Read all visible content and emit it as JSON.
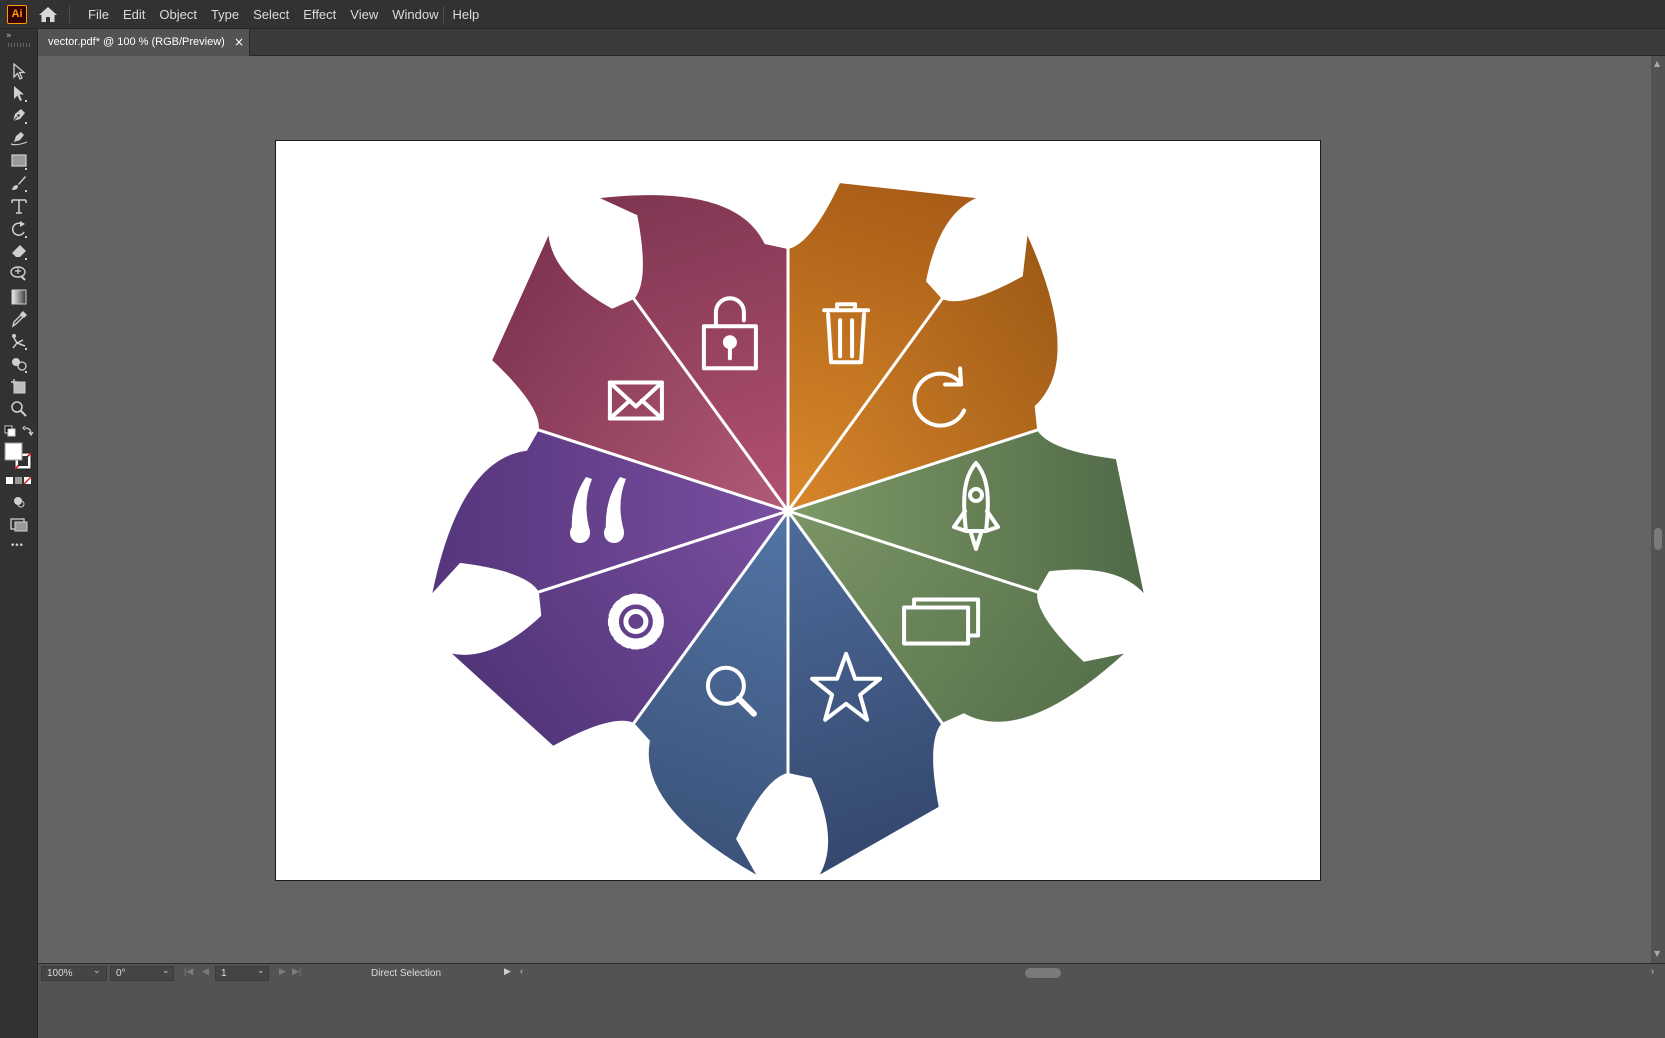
{
  "app": {
    "logo_text": "Ai",
    "brand_color": "#ff9a00",
    "menus": [
      "File",
      "Edit",
      "Object",
      "Type",
      "Select",
      "Effect",
      "View",
      "Window",
      "Help"
    ]
  },
  "document": {
    "tab_title": "vector.pdf* @ 100 % (RGB/Preview)",
    "close_glyph": "×"
  },
  "toolbar": {
    "collapse_glyph": "»",
    "tools": [
      "selection-tool",
      "direct-selection-tool",
      "pen-tool",
      "curvature-tool",
      "rectangle-tool",
      "paintbrush-tool",
      "type-tool",
      "rotate-tool",
      "eraser-tool",
      "width-tool",
      "gradient-tool",
      "eyedropper-tool",
      "puppet-warp-tool",
      "shape-builder-tool",
      "artboard-tool",
      "zoom-tool"
    ],
    "fill_color": "#ffffff",
    "stroke": "none",
    "more_glyph": "•••"
  },
  "artwork": {
    "segments": [
      {
        "icon": "trash-icon",
        "color_light": "#d98a2a",
        "color_dark": "#a65a16"
      },
      {
        "icon": "refresh-icon",
        "color_light": "#d8862a",
        "color_dark": "#9d5916"
      },
      {
        "icon": "rocket-icon",
        "color_light": "#7e9a66",
        "color_dark": "#4f6848"
      },
      {
        "icon": "windows-icon",
        "color_light": "#7b9566",
        "color_dark": "#55704b"
      },
      {
        "icon": "star-icon",
        "color_light": "#4d6b9a",
        "color_dark": "#34476d"
      },
      {
        "icon": "magnifier-icon",
        "color_light": "#5275a5",
        "color_dark": "#3b5279"
      },
      {
        "icon": "gear-icon",
        "color_light": "#7a4fa0",
        "color_dark": "#4f3477"
      },
      {
        "icon": "quote-icon",
        "color_light": "#7a4fa2",
        "color_dark": "#54357a"
      },
      {
        "icon": "envelope-icon",
        "color_light": "#b25a76",
        "color_dark": "#7e3351"
      },
      {
        "icon": "padlock-icon",
        "color_light": "#b25073",
        "color_dark": "#7d3550"
      }
    ]
  },
  "statusbar": {
    "zoom": "100%",
    "rotation": "0°",
    "artboard_number": "1",
    "current_tool": "Direct Selection"
  }
}
